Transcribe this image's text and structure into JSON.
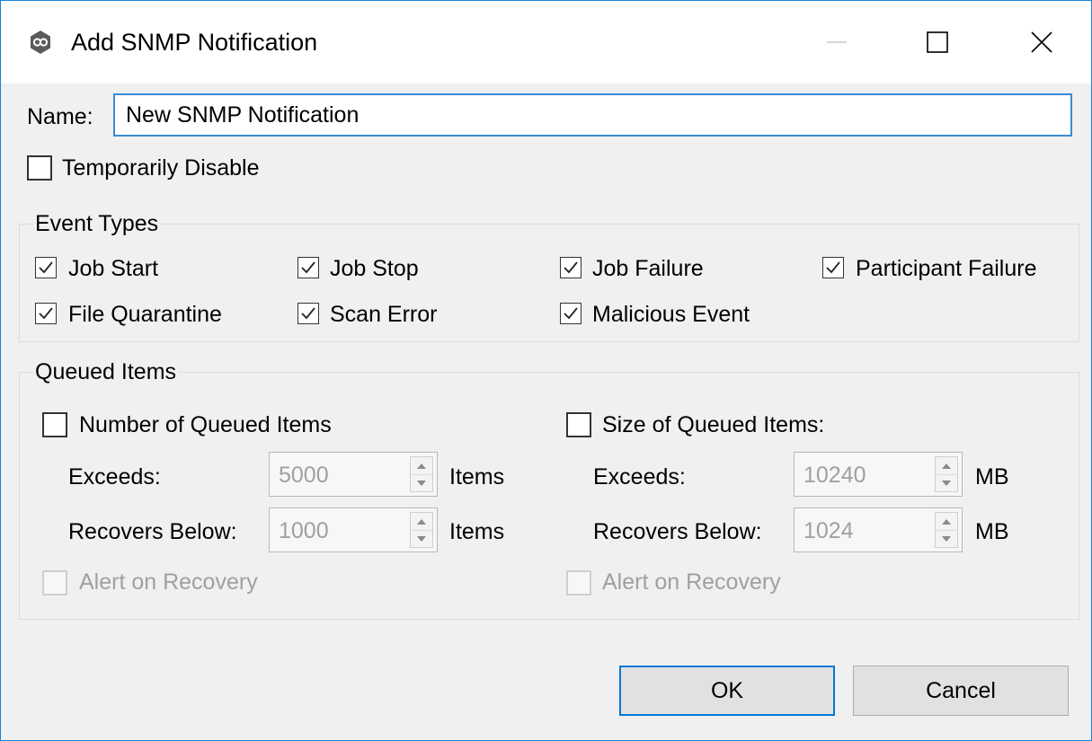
{
  "window": {
    "title": "Add SNMP Notification"
  },
  "form": {
    "name_label": "Name:",
    "name_value": "New SNMP Notification",
    "temporarily_disable_label": "Temporarily Disable",
    "temporarily_disable_checked": false
  },
  "event_types": {
    "title": "Event Types",
    "items": [
      {
        "label": "Job Start",
        "checked": true
      },
      {
        "label": "Job Stop",
        "checked": true
      },
      {
        "label": "Job Failure",
        "checked": true
      },
      {
        "label": "Participant Failure",
        "checked": true
      },
      {
        "label": "File Quarantine",
        "checked": true
      },
      {
        "label": "Scan Error",
        "checked": true
      },
      {
        "label": "Malicious Event",
        "checked": true
      }
    ]
  },
  "queued_items": {
    "title": "Queued Items",
    "number": {
      "label": "Number of Queued Items",
      "checked": false,
      "exceeds_label": "Exceeds:",
      "exceeds_value": "5000",
      "exceeds_unit": "Items",
      "recovers_label": "Recovers Below:",
      "recovers_value": "1000",
      "recovers_unit": "Items",
      "alert_label": "Alert on Recovery"
    },
    "size": {
      "label": "Size of Queued Items:",
      "checked": false,
      "exceeds_label": "Exceeds:",
      "exceeds_value": "10240",
      "exceeds_unit": "MB",
      "recovers_label": "Recovers Below:",
      "recovers_value": "1024",
      "recovers_unit": "MB",
      "alert_label": "Alert on Recovery"
    }
  },
  "buttons": {
    "ok": "OK",
    "cancel": "Cancel"
  },
  "colors": {
    "accent": "#0078d7",
    "focus_border": "#3a8ad6",
    "window_border": "#1883d7"
  }
}
